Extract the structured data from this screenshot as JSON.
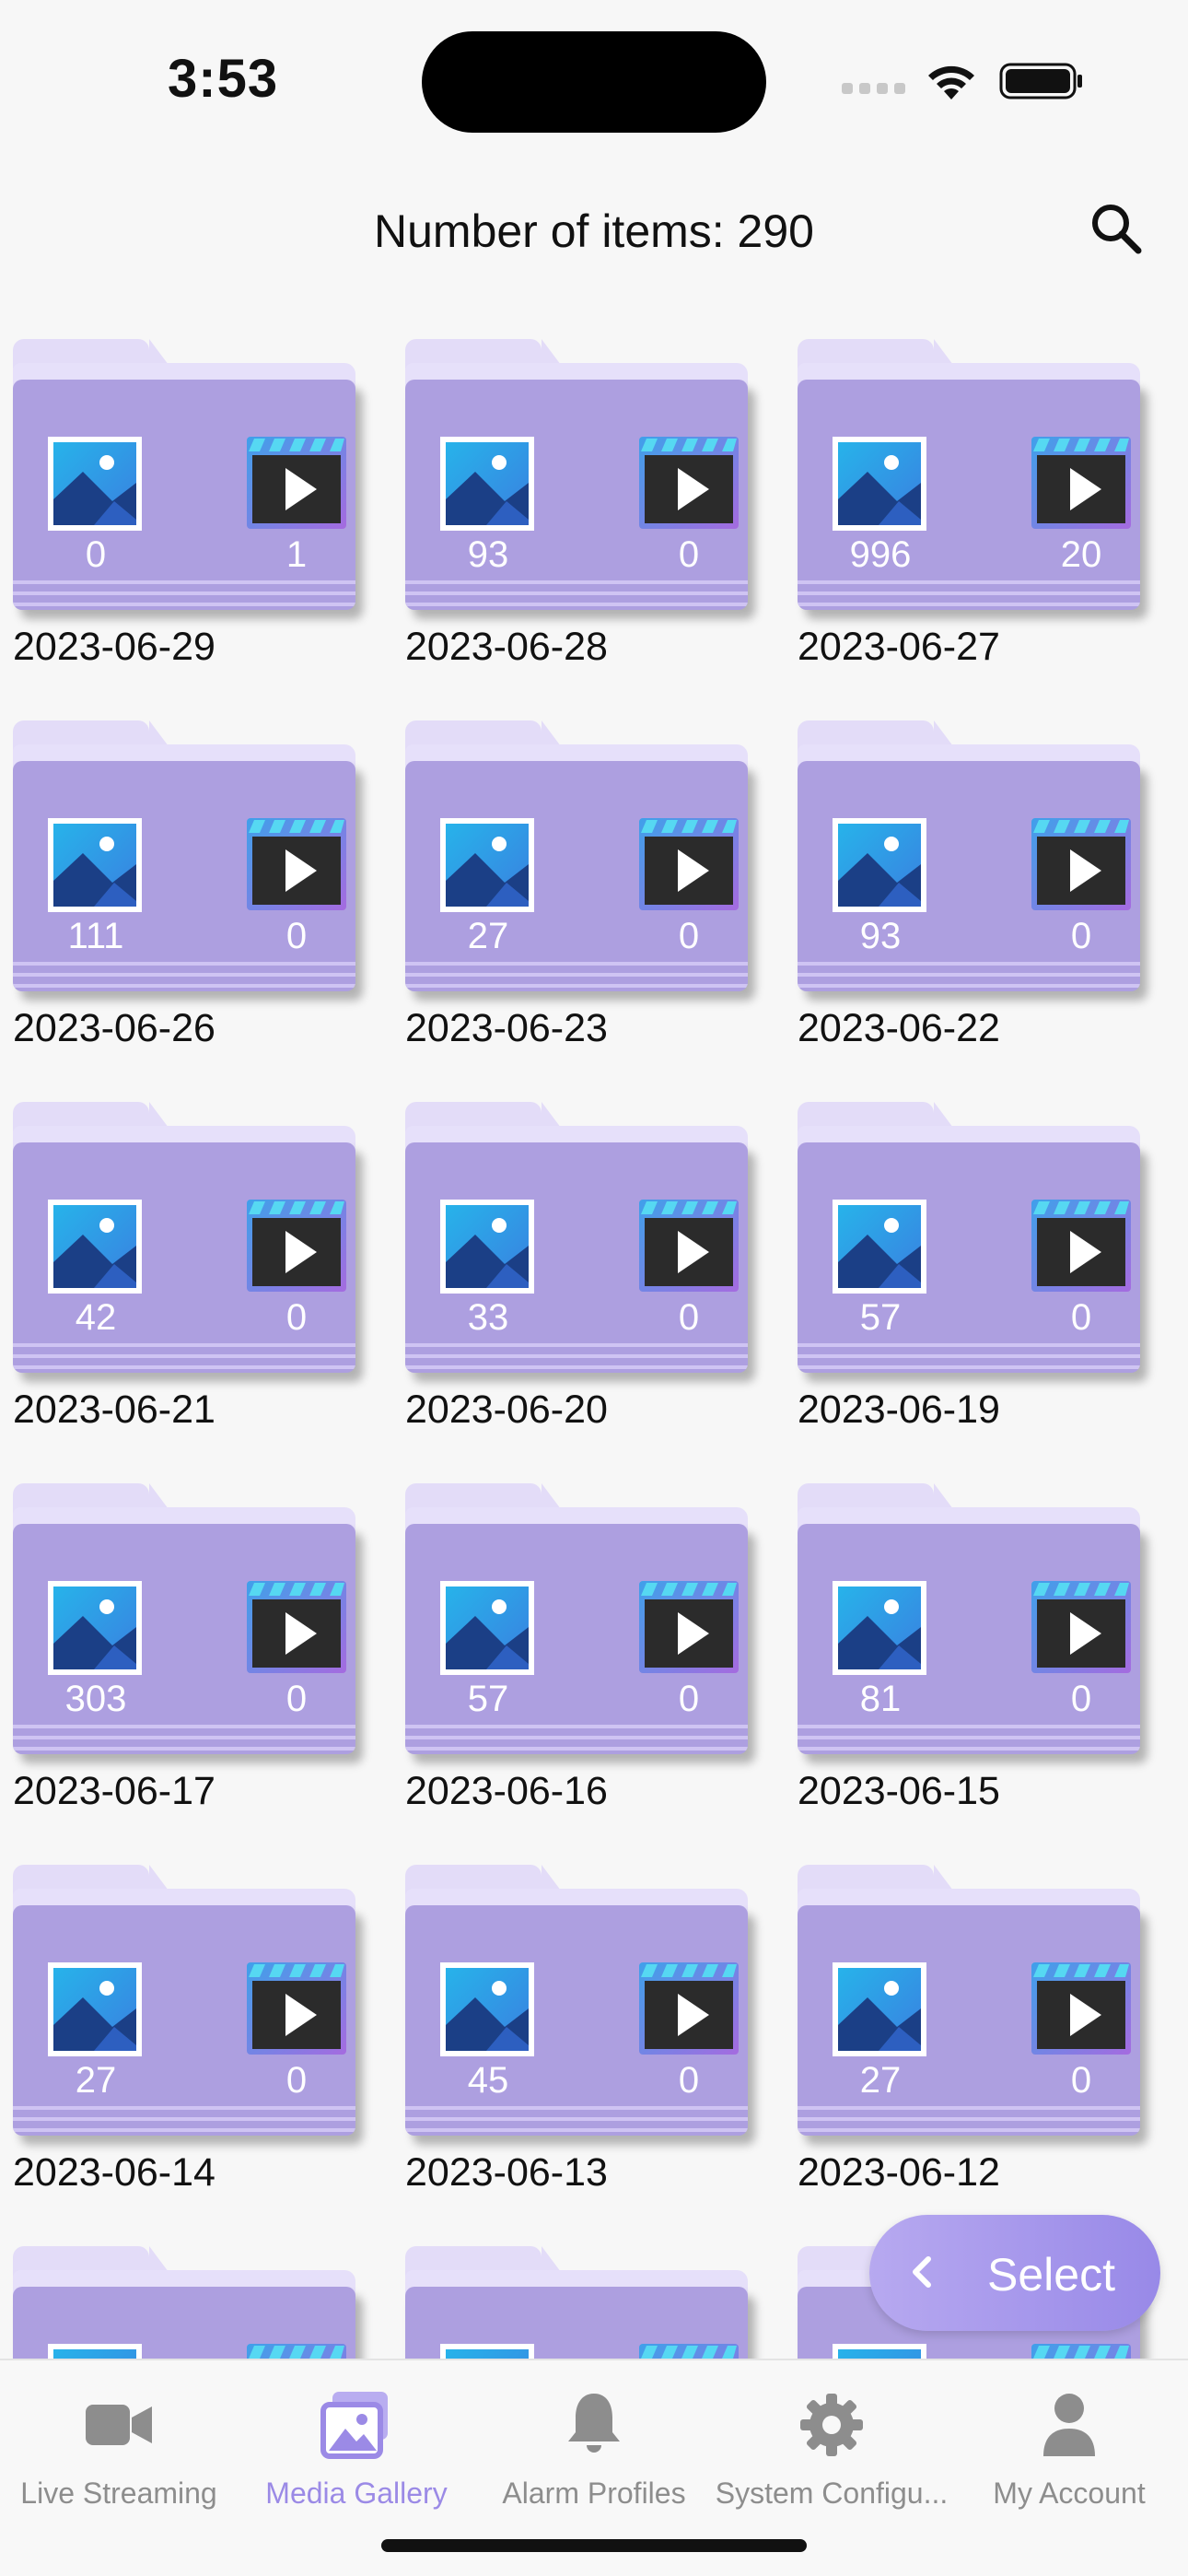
{
  "status_bar": {
    "time": "3:53"
  },
  "header": {
    "title": "Number of items: 290"
  },
  "folders": [
    {
      "date": "2023-06-29",
      "photos": "0",
      "videos": "1"
    },
    {
      "date": "2023-06-28",
      "photos": "93",
      "videos": "0"
    },
    {
      "date": "2023-06-27",
      "photos": "996",
      "videos": "20"
    },
    {
      "date": "2023-06-26",
      "photos": "111",
      "videos": "0"
    },
    {
      "date": "2023-06-23",
      "photos": "27",
      "videos": "0"
    },
    {
      "date": "2023-06-22",
      "photos": "93",
      "videos": "0"
    },
    {
      "date": "2023-06-21",
      "photos": "42",
      "videos": "0"
    },
    {
      "date": "2023-06-20",
      "photos": "33",
      "videos": "0"
    },
    {
      "date": "2023-06-19",
      "photos": "57",
      "videos": "0"
    },
    {
      "date": "2023-06-17",
      "photos": "303",
      "videos": "0"
    },
    {
      "date": "2023-06-16",
      "photos": "57",
      "videos": "0"
    },
    {
      "date": "2023-06-15",
      "photos": "81",
      "videos": "0"
    },
    {
      "date": "2023-06-14",
      "photos": "27",
      "videos": "0"
    },
    {
      "date": "2023-06-13",
      "photos": "45",
      "videos": "0"
    },
    {
      "date": "2023-06-12",
      "photos": "27",
      "videos": "0"
    },
    {
      "date": "",
      "photos": "",
      "videos": ""
    },
    {
      "date": "",
      "photos": "",
      "videos": ""
    },
    {
      "date": "",
      "photos": "",
      "videos": ""
    }
  ],
  "select_button": {
    "label": "Select"
  },
  "tabs": [
    {
      "label": "Live Streaming",
      "icon": "video-camera-icon",
      "active": false
    },
    {
      "label": "Media Gallery",
      "icon": "media-gallery-icon",
      "active": true
    },
    {
      "label": "Alarm Profiles",
      "icon": "bell-icon",
      "active": false
    },
    {
      "label": "System Configu...",
      "icon": "gear-icon",
      "active": false
    },
    {
      "label": "My Account",
      "icon": "person-icon",
      "active": false
    }
  ],
  "colors": {
    "accent": "#9b8ae6",
    "folder": "#ad9fe0",
    "folder_light": "#e3dcf8",
    "tab_inactive": "#8d8d8d"
  }
}
